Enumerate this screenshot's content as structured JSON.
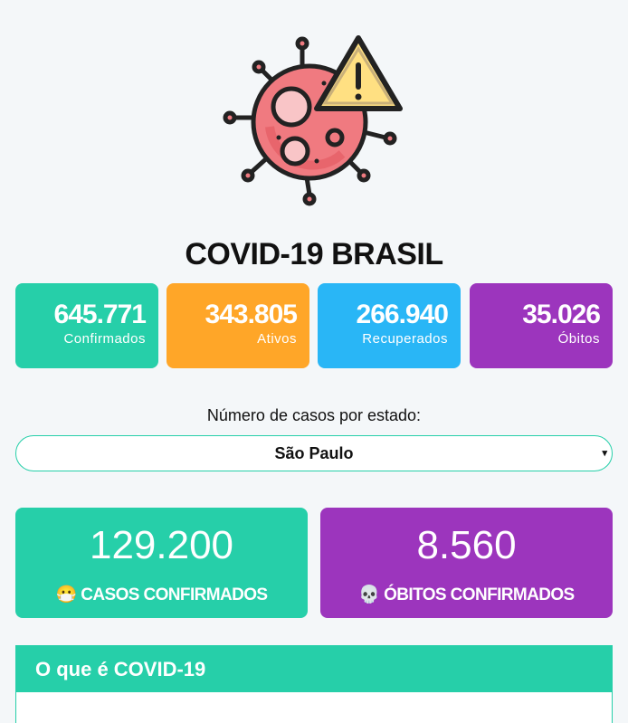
{
  "app": {
    "title": "COVID-19 BRASIL"
  },
  "stats": [
    {
      "value": "645.771",
      "label": "Confirmados",
      "color": "#26cfa9"
    },
    {
      "value": "343.805",
      "label": "Ativos",
      "color": "#ffa628"
    },
    {
      "value": "266.940",
      "label": "Recuperados",
      "color": "#29b6f6"
    },
    {
      "value": "35.026",
      "label": "Óbitos",
      "color": "#9c35bd"
    }
  ],
  "state_select": {
    "label": "Número de casos por estado:",
    "selected": "São Paulo",
    "arrow": "▾"
  },
  "state_stats": {
    "cases": {
      "value": "129.200",
      "icon": "😷",
      "label": "CASOS CONFIRMADOS",
      "color": "#26cfa9"
    },
    "deaths": {
      "value": "8.560",
      "icon": "💀",
      "label": "ÓBITOS CONFIRMADOS",
      "color": "#9c35bd"
    }
  },
  "info": {
    "heading": "O que é COVID-19"
  }
}
